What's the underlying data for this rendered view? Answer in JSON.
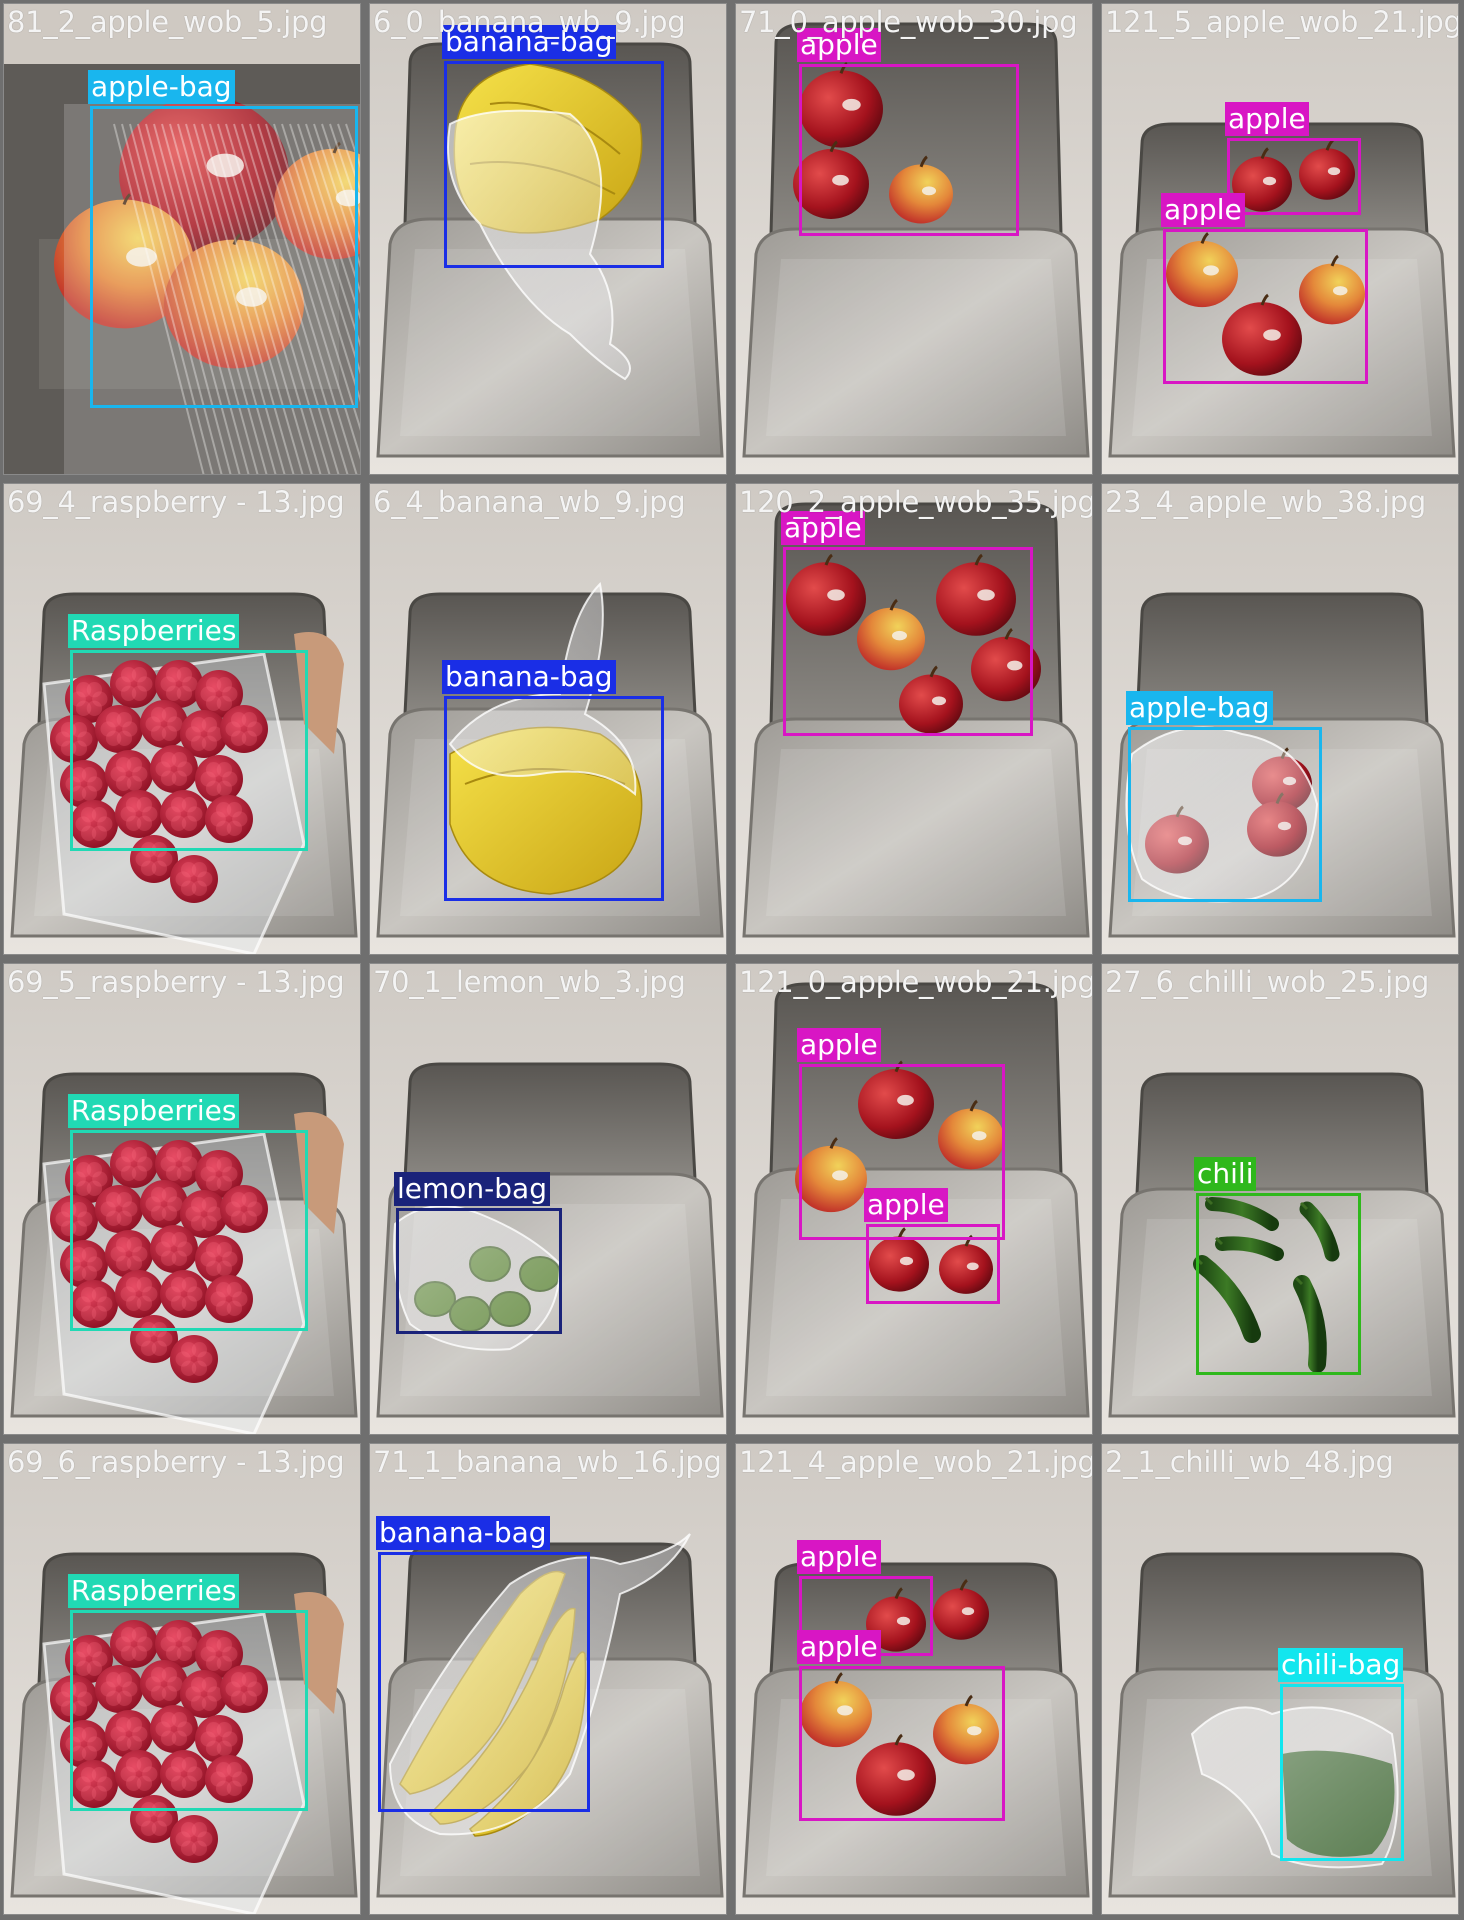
{
  "colors": {
    "apple": "#d816c4",
    "apple-bag": "#19b6ee",
    "banana-bag": "#1a2ee6",
    "Raspberries": "#21d9b4",
    "lemon-bag": "#1a237a",
    "chili": "#2fb81c",
    "chili-bag": "#12e6ee"
  },
  "tiles": [
    {
      "file": "81_2_apple_wob_5.jpg",
      "scene": "apple-bag-blur",
      "boxes": [
        {
          "label": "apple-bag"
        }
      ]
    },
    {
      "file": "6_0_banana_wb_9.jpg",
      "scene": "banana-top",
      "boxes": [
        {
          "label": "banana-bag"
        }
      ]
    },
    {
      "file": "71_0_apple_wob_30.jpg",
      "scene": "apples-three",
      "boxes": [
        {
          "label": "apple"
        }
      ]
    },
    {
      "file": "121_5_apple_wob_21.jpg",
      "scene": "apples-two-groups",
      "boxes": [
        {
          "label": "apple"
        },
        {
          "label": "apple"
        }
      ]
    },
    {
      "file": "69_4_raspberry - 13.jpg",
      "scene": "raspberries",
      "boxes": [
        {
          "label": "Raspberries"
        }
      ]
    },
    {
      "file": "6_4_banana_wb_9.jpg",
      "scene": "banana-bottom",
      "boxes": [
        {
          "label": "banana-bag"
        }
      ]
    },
    {
      "file": "120_2_apple_wob_35.jpg",
      "scene": "apples-five",
      "boxes": [
        {
          "label": "apple"
        }
      ]
    },
    {
      "file": "23_4_apple_wb_38.jpg",
      "scene": "apple-bag-tray",
      "boxes": [
        {
          "label": "apple-bag"
        }
      ]
    },
    {
      "file": "69_5_raspberry - 13.jpg",
      "scene": "raspberries",
      "boxes": [
        {
          "label": "Raspberries"
        }
      ]
    },
    {
      "file": "70_1_lemon_wb_3.jpg",
      "scene": "lemon-bag",
      "boxes": [
        {
          "label": "lemon-bag"
        }
      ]
    },
    {
      "file": "121_0_apple_wob_21.jpg",
      "scene": "apples-two-groups-b",
      "boxes": [
        {
          "label": "apple"
        },
        {
          "label": "apple"
        }
      ]
    },
    {
      "file": "27_6_chilli_wob_25.jpg",
      "scene": "chilis",
      "boxes": [
        {
          "label": "chili"
        }
      ]
    },
    {
      "file": "69_6_raspberry - 13.jpg",
      "scene": "raspberries",
      "boxes": [
        {
          "label": "Raspberries"
        }
      ]
    },
    {
      "file": "71_1_banana_wb_16.jpg",
      "scene": "banana-long",
      "boxes": [
        {
          "label": "banana-bag"
        }
      ]
    },
    {
      "file": "121_4_apple_wob_21.jpg",
      "scene": "apples-two-groups",
      "boxes": [
        {
          "label": "apple"
        },
        {
          "label": "apple"
        }
      ]
    },
    {
      "file": "2_1_chilli_wb_48.jpg",
      "scene": "chili-bag",
      "boxes": [
        {
          "label": "chili-bag"
        }
      ]
    }
  ]
}
